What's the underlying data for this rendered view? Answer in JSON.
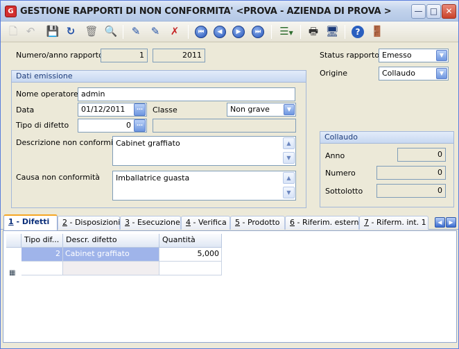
{
  "window": {
    "title": "GESTIONE RAPPORTI DI NON CONFORMITA' <PROVA - AZIENDA DI PROVA >",
    "app_icon_letter": "G"
  },
  "toolbar": {
    "icons": [
      "new-icon",
      "undo-icon",
      "save-icon",
      "refresh-icon",
      "delete-icon",
      "find-icon",
      "edit-icon",
      "edit-check-icon",
      "edit-cancel-icon",
      "first-record-icon",
      "previous-record-icon",
      "next-record-icon",
      "last-record-icon",
      "list-icon",
      "print-icon",
      "preview-icon",
      "help-icon",
      "exit-icon"
    ]
  },
  "header": {
    "numero_anno_label": "Numero/anno rapporto",
    "numero": "1",
    "anno": "2011",
    "status_label": "Status rapporto",
    "status_value": "Emesso",
    "origine_label": "Origine",
    "origine_value": "Collaudo"
  },
  "emissione": {
    "group_title": "Dati emissione",
    "operatore_label": "Nome operatore",
    "operatore_value": "admin",
    "data_label": "Data",
    "data_value": "01/12/2011",
    "classe_label": "Classe",
    "classe_value": "Non grave",
    "tipo_label": "Tipo di difetto",
    "tipo_value": "0",
    "tipo_desc": "",
    "descrizione_label": "Descrizione non conformità",
    "descrizione_value": "Cabinet graffiato",
    "causa_label": "Causa non conformità",
    "causa_value": "Imballatrice guasta"
  },
  "collaudo": {
    "group_title": "Collaudo",
    "anno_label": "Anno",
    "anno_value": "0",
    "numero_label": "Numero",
    "numero_value": "0",
    "sottolotto_label": "Sottolotto",
    "sottolotto_value": "0"
  },
  "tabs": [
    {
      "key": "1",
      "label": " - Difetti"
    },
    {
      "key": "2",
      "label": " - Disposizioni"
    },
    {
      "key": "3",
      "label": " - Esecuzione"
    },
    {
      "key": "4",
      "label": " - Verifica"
    },
    {
      "key": "5",
      "label": " - Prodotto"
    },
    {
      "key": "6",
      "label": " - Riferim. esterni"
    },
    {
      "key": "7",
      "label": " - Riferm. int. 1"
    }
  ],
  "grid": {
    "columns": [
      "Tipo dif...",
      "Descr. difetto",
      "Quantità"
    ],
    "rows": [
      {
        "tipo": "2",
        "descr": "Cabinet graffiato",
        "quantita": "5,000"
      }
    ]
  },
  "colors": {
    "window_bg": "#ece9d8",
    "accent": "#5a7fcb",
    "selected_row": "#9fb4ea"
  }
}
